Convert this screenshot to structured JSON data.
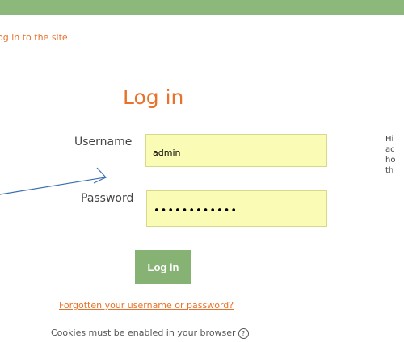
{
  "header": {
    "color": "#8db87b"
  },
  "breadcrumb": {
    "text": "og in to the site"
  },
  "login": {
    "title": "Log in",
    "username_label": "Username",
    "username_value": "admin",
    "password_label": "Password",
    "password_value": "••••••••••••",
    "button_label": "Log in",
    "forgot_link": "Forgotten your username or password?",
    "cookies_notice": "Cookies must be enabled in your browser",
    "help_icon": "question-circle-icon"
  },
  "side_text": {
    "lines": [
      "Hi",
      "ac",
      "ho",
      "th"
    ]
  },
  "annotation": {
    "arrow_icon": "arrow-icon",
    "color": "#3a6fb0"
  },
  "colors": {
    "accent": "#e8722a",
    "button": "#86b274",
    "field_bg": "#fafcb5"
  }
}
